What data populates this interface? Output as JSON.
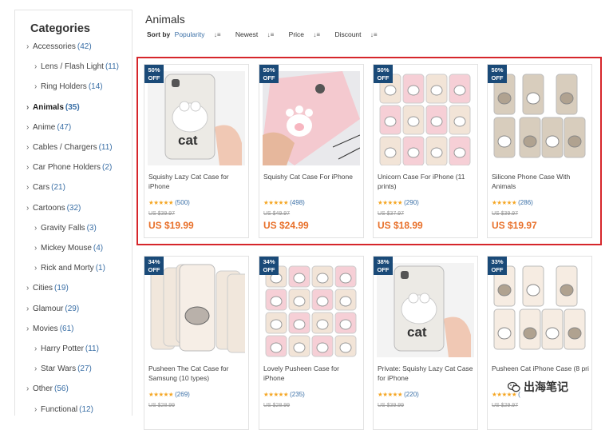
{
  "sidebar": {
    "title": "Categories",
    "items": [
      {
        "label": "Accessories",
        "count": "(42)",
        "level": 0,
        "active": false
      },
      {
        "label": "Lens / Flash Light",
        "count": "(11)",
        "level": 1,
        "active": false
      },
      {
        "label": "Ring Holders",
        "count": "(14)",
        "level": 1,
        "active": false
      },
      {
        "label": "Animals",
        "count": "(35)",
        "level": 0,
        "active": true
      },
      {
        "label": "Anime",
        "count": "(47)",
        "level": 0,
        "active": false
      },
      {
        "label": "Cables / Chargers",
        "count": "(11)",
        "level": 0,
        "active": false
      },
      {
        "label": "Car Phone Holders",
        "count": "(2)",
        "level": 0,
        "active": false
      },
      {
        "label": "Cars",
        "count": "(21)",
        "level": 0,
        "active": false
      },
      {
        "label": "Cartoons",
        "count": "(32)",
        "level": 0,
        "active": false
      },
      {
        "label": "Gravity Falls",
        "count": "(3)",
        "level": 1,
        "active": false
      },
      {
        "label": "Mickey Mouse",
        "count": "(4)",
        "level": 1,
        "active": false
      },
      {
        "label": "Rick and Morty",
        "count": "(1)",
        "level": 1,
        "active": false
      },
      {
        "label": "Cities",
        "count": "(19)",
        "level": 0,
        "active": false
      },
      {
        "label": "Glamour",
        "count": "(29)",
        "level": 0,
        "active": false
      },
      {
        "label": "Movies",
        "count": "(61)",
        "level": 0,
        "active": false
      },
      {
        "label": "Harry Potter",
        "count": "(11)",
        "level": 1,
        "active": false
      },
      {
        "label": "Star Wars",
        "count": "(27)",
        "level": 1,
        "active": false
      },
      {
        "label": "Other",
        "count": "(56)",
        "level": 0,
        "active": false
      },
      {
        "label": "Functional",
        "count": "(12)",
        "level": 1,
        "active": false
      }
    ]
  },
  "main": {
    "title": "Animals",
    "sort": {
      "label": "Sort by",
      "options": [
        "Popularity",
        "Newest",
        "Price",
        "Discount"
      ],
      "selected": "Popularity"
    }
  },
  "products": [
    {
      "badge_pct": "50%",
      "badge_off": "OFF",
      "name": "Squishy Lazy Cat Case for iPhone",
      "stars": "★★★★★",
      "reviews": "(500)",
      "old_price": "US $39.97",
      "price": "US $19.99",
      "img": "cat-case"
    },
    {
      "badge_pct": "50%",
      "badge_off": "OFF",
      "name": "Squishy Cat Case For iPhone",
      "stars": "★★★★★",
      "reviews": "(498)",
      "old_price": "US $49.97",
      "price": "US $24.99",
      "img": "paw-case"
    },
    {
      "badge_pct": "50%",
      "badge_off": "OFF",
      "name": "Unicorn Case For iPhone (11 prints)",
      "stars": "★★★★★",
      "reviews": "(290)",
      "old_price": "US $37.97",
      "price": "US $18.99",
      "img": "unicorn-cases"
    },
    {
      "badge_pct": "50%",
      "badge_off": "OFF",
      "name": "Silicone Phone Case With Animals",
      "stars": "★★★★★",
      "reviews": "(286)",
      "old_price": "US $39.97",
      "price": "US $19.97",
      "img": "animal-cases"
    },
    {
      "badge_pct": "34%",
      "badge_off": "OFF",
      "name": "Pusheen The Cat Case for Samsung (10 types)",
      "stars": "★★★★★",
      "reviews": "(269)",
      "old_price": "US $28.99",
      "price": "",
      "img": "pusheen-samsung"
    },
    {
      "badge_pct": "34%",
      "badge_off": "OFF",
      "name": "Lovely Pusheen Case for iPhone",
      "stars": "★★★★★",
      "reviews": "(235)",
      "old_price": "US $28.99",
      "price": "",
      "img": "pusheen-lovely"
    },
    {
      "badge_pct": "38%",
      "badge_off": "OFF",
      "name": "Private: Squishy Lazy Cat Case for iPhone",
      "stars": "★★★★★",
      "reviews": "(220)",
      "old_price": "US $39.99",
      "price": "",
      "img": "cat-case-2"
    },
    {
      "badge_pct": "33%",
      "badge_off": "OFF",
      "name": "Pusheen Cat iPhone Case (8 pri",
      "stars": "★★★★★",
      "reviews": "(",
      "old_price": "US $29.97",
      "price": "",
      "img": "pusheen-iphone"
    }
  ],
  "watermark": {
    "text": "出海笔记",
    "icon": "wechat-icon"
  },
  "colors": {
    "accent": "#3a6fa6",
    "badge": "#1a4a78",
    "price": "#e8702a",
    "stars": "#f5a623",
    "highlight": "#d6262b"
  }
}
